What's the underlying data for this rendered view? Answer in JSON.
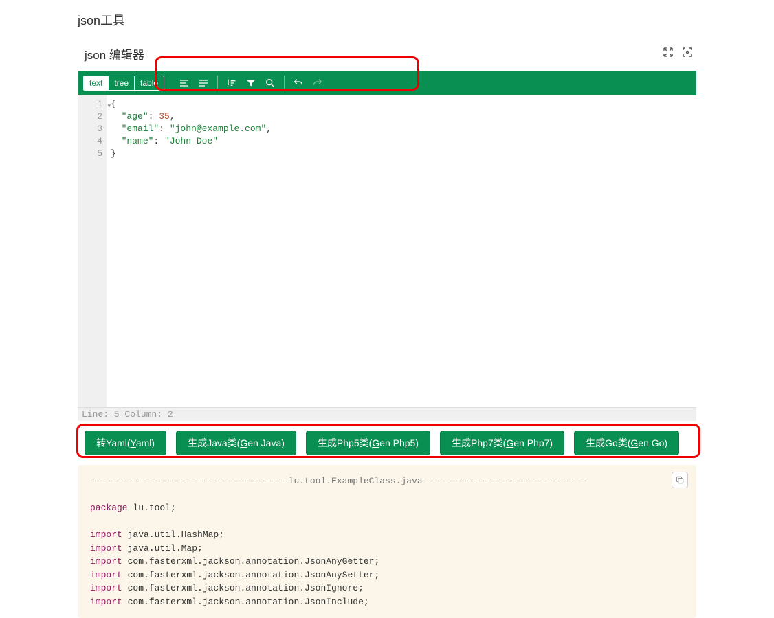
{
  "page_title": "json工具",
  "editor": {
    "title": "json 编辑器",
    "modes": {
      "text": "text",
      "tree": "tree",
      "table": "table"
    },
    "active_mode": "text",
    "code_lines": [
      {
        "n": 1,
        "tokens": [
          {
            "t": "brace",
            "v": "{"
          }
        ]
      },
      {
        "n": 2,
        "tokens": [
          {
            "t": "indent",
            "v": "  "
          },
          {
            "t": "key",
            "v": "\"age\""
          },
          {
            "t": "punct",
            "v": ": "
          },
          {
            "t": "num",
            "v": "35"
          },
          {
            "t": "punct",
            "v": ","
          }
        ]
      },
      {
        "n": 3,
        "tokens": [
          {
            "t": "indent",
            "v": "  "
          },
          {
            "t": "key",
            "v": "\"email\""
          },
          {
            "t": "punct",
            "v": ": "
          },
          {
            "t": "str",
            "v": "\"john@example.com\""
          },
          {
            "t": "punct",
            "v": ","
          }
        ]
      },
      {
        "n": 4,
        "tokens": [
          {
            "t": "indent",
            "v": "  "
          },
          {
            "t": "key",
            "v": "\"name\""
          },
          {
            "t": "punct",
            "v": ": "
          },
          {
            "t": "str",
            "v": "\"John Doe\""
          }
        ]
      },
      {
        "n": 5,
        "tokens": [
          {
            "t": "brace",
            "v": "}"
          }
        ]
      }
    ],
    "status": "Line: 5  Column: 2"
  },
  "actions": {
    "yaml": "转Yaml(Yaml)",
    "java": "生成Java类(Gen Java)",
    "php5": "生成Php5类(Gen Php5)",
    "php7": "生成Php7类(Gen Php7)",
    "go": "生成Go类(Gen Go)"
  },
  "output": {
    "header_dashes_left": "-------------------------------------",
    "header_filename": "lu.tool.ExampleClass.java",
    "header_dashes_right": "-------------------------------",
    "package_kw": "package",
    "package_val": " lu.tool;",
    "import_kw": "import",
    "imports": [
      " java.util.HashMap;",
      " java.util.Map;",
      " com.fasterxml.jackson.annotation.JsonAnyGetter;",
      " com.fasterxml.jackson.annotation.JsonAnySetter;",
      " com.fasterxml.jackson.annotation.JsonIgnore;",
      " com.fasterxml.jackson.annotation.JsonInclude;"
    ]
  }
}
